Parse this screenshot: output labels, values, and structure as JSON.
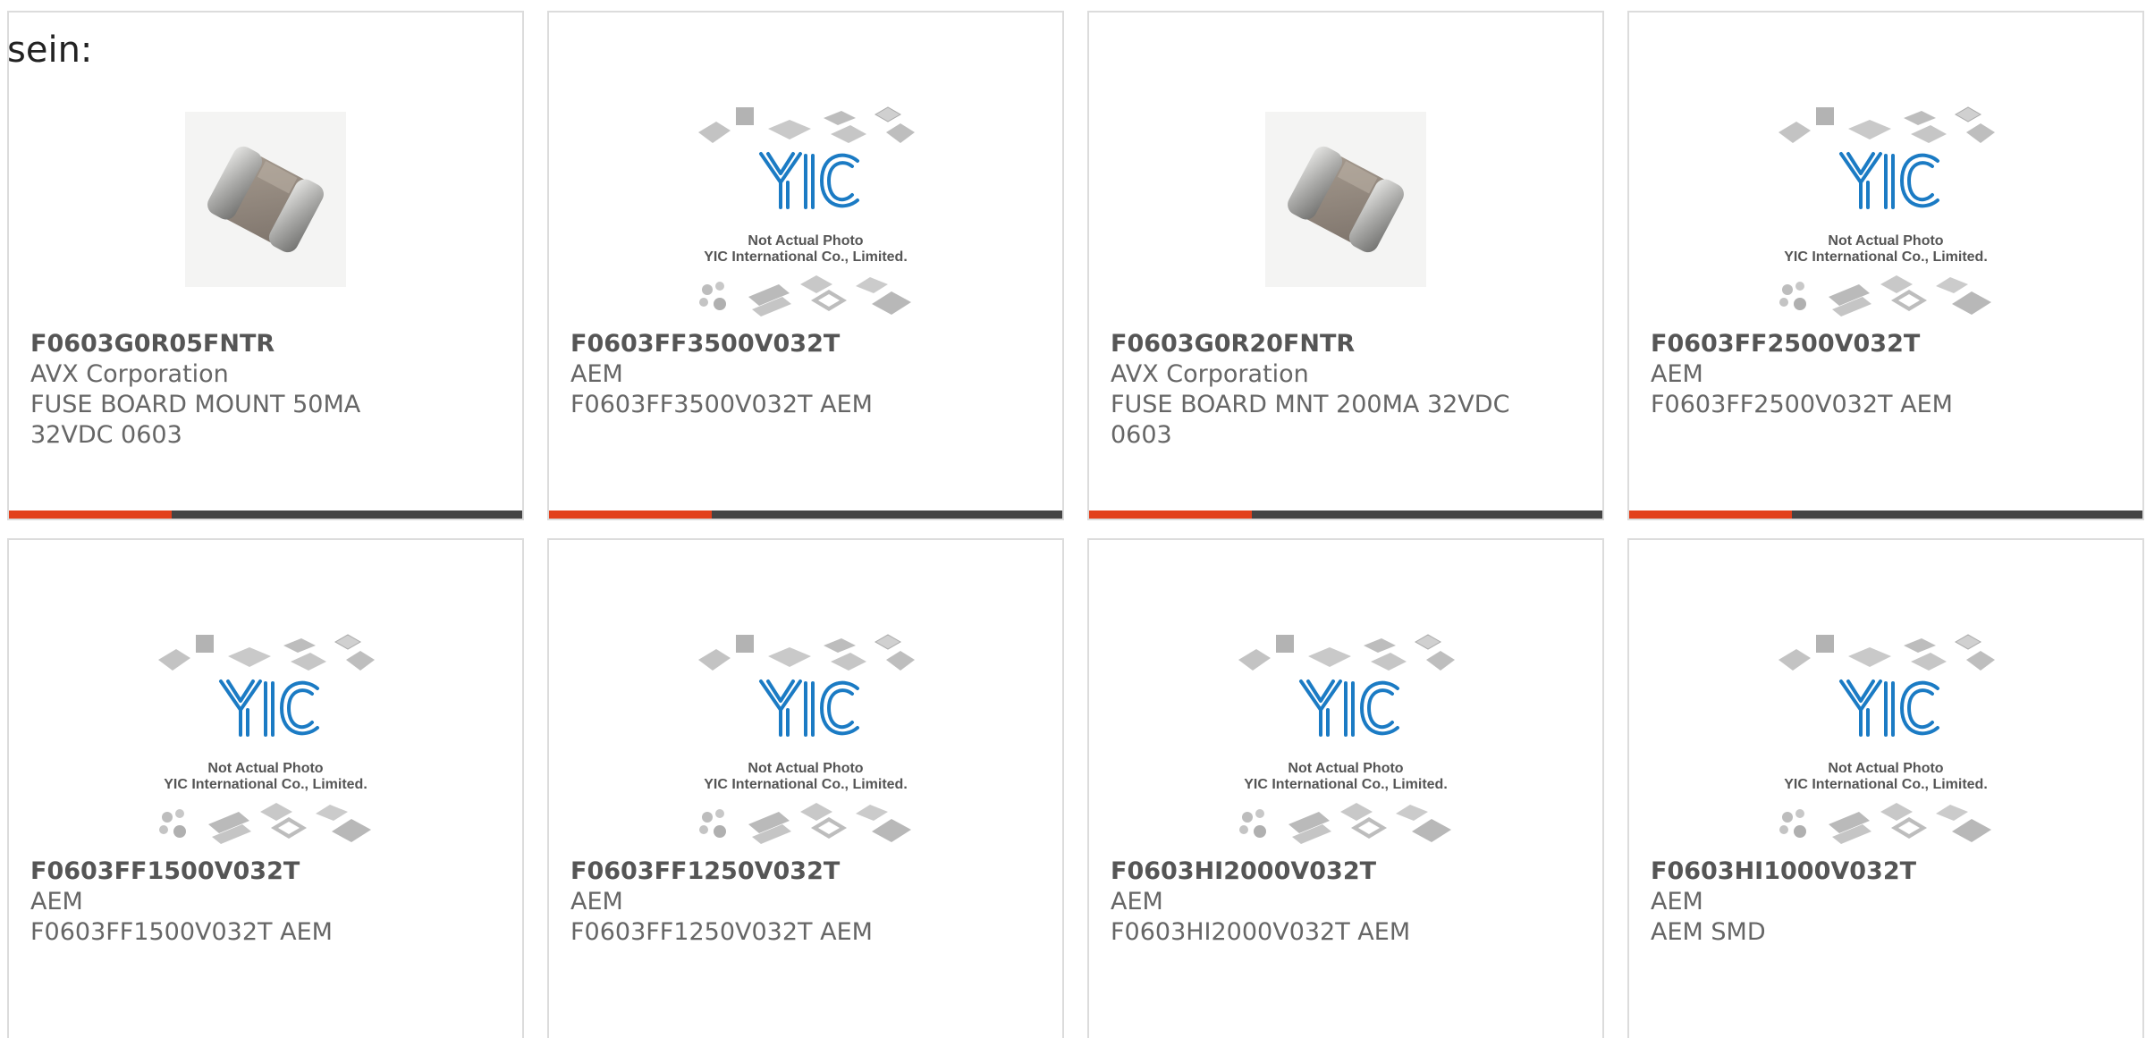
{
  "header": {
    "label": "sein:"
  },
  "colors": {
    "accent": "#e2401c",
    "bar": "#444444",
    "logo": "#1b7bc4"
  },
  "placeholder": {
    "line1": "Not Actual Photo",
    "line2": "YIC International Co., Limited."
  },
  "products": [
    {
      "part": "F0603G0R05FNTR",
      "manufacturer": "AVX Corporation",
      "desc1": "FUSE BOARD MOUNT 50MA",
      "desc2": "32VDC 0603",
      "image": "chip-fuse-photo",
      "has_bar": true
    },
    {
      "part": "F0603FF3500V032T",
      "manufacturer": "AEM",
      "desc1": "F0603FF3500V032T AEM",
      "desc2": "",
      "image": "yic-placeholder",
      "has_bar": true
    },
    {
      "part": "F0603G0R20FNTR",
      "manufacturer": "AVX Corporation",
      "desc1": "FUSE BOARD MNT 200MA 32VDC",
      "desc2": "0603",
      "image": "chip-fuse-photo",
      "has_bar": true
    },
    {
      "part": "F0603FF2500V032T",
      "manufacturer": "AEM",
      "desc1": "F0603FF2500V032T AEM",
      "desc2": "",
      "image": "yic-placeholder",
      "has_bar": true
    },
    {
      "part": "F0603FF1500V032T",
      "manufacturer": "AEM",
      "desc1": "F0603FF1500V032T AEM",
      "desc2": "",
      "image": "yic-placeholder",
      "has_bar": false
    },
    {
      "part": "F0603FF1250V032T",
      "manufacturer": "AEM",
      "desc1": "F0603FF1250V032T AEM",
      "desc2": "",
      "image": "yic-placeholder",
      "has_bar": false
    },
    {
      "part": "F0603HI2000V032T",
      "manufacturer": "AEM",
      "desc1": "F0603HI2000V032T AEM",
      "desc2": "",
      "image": "yic-placeholder",
      "has_bar": false
    },
    {
      "part": "F0603HI1000V032T",
      "manufacturer": "AEM",
      "desc1": "AEM SMD",
      "desc2": "",
      "image": "yic-placeholder",
      "has_bar": false
    }
  ]
}
